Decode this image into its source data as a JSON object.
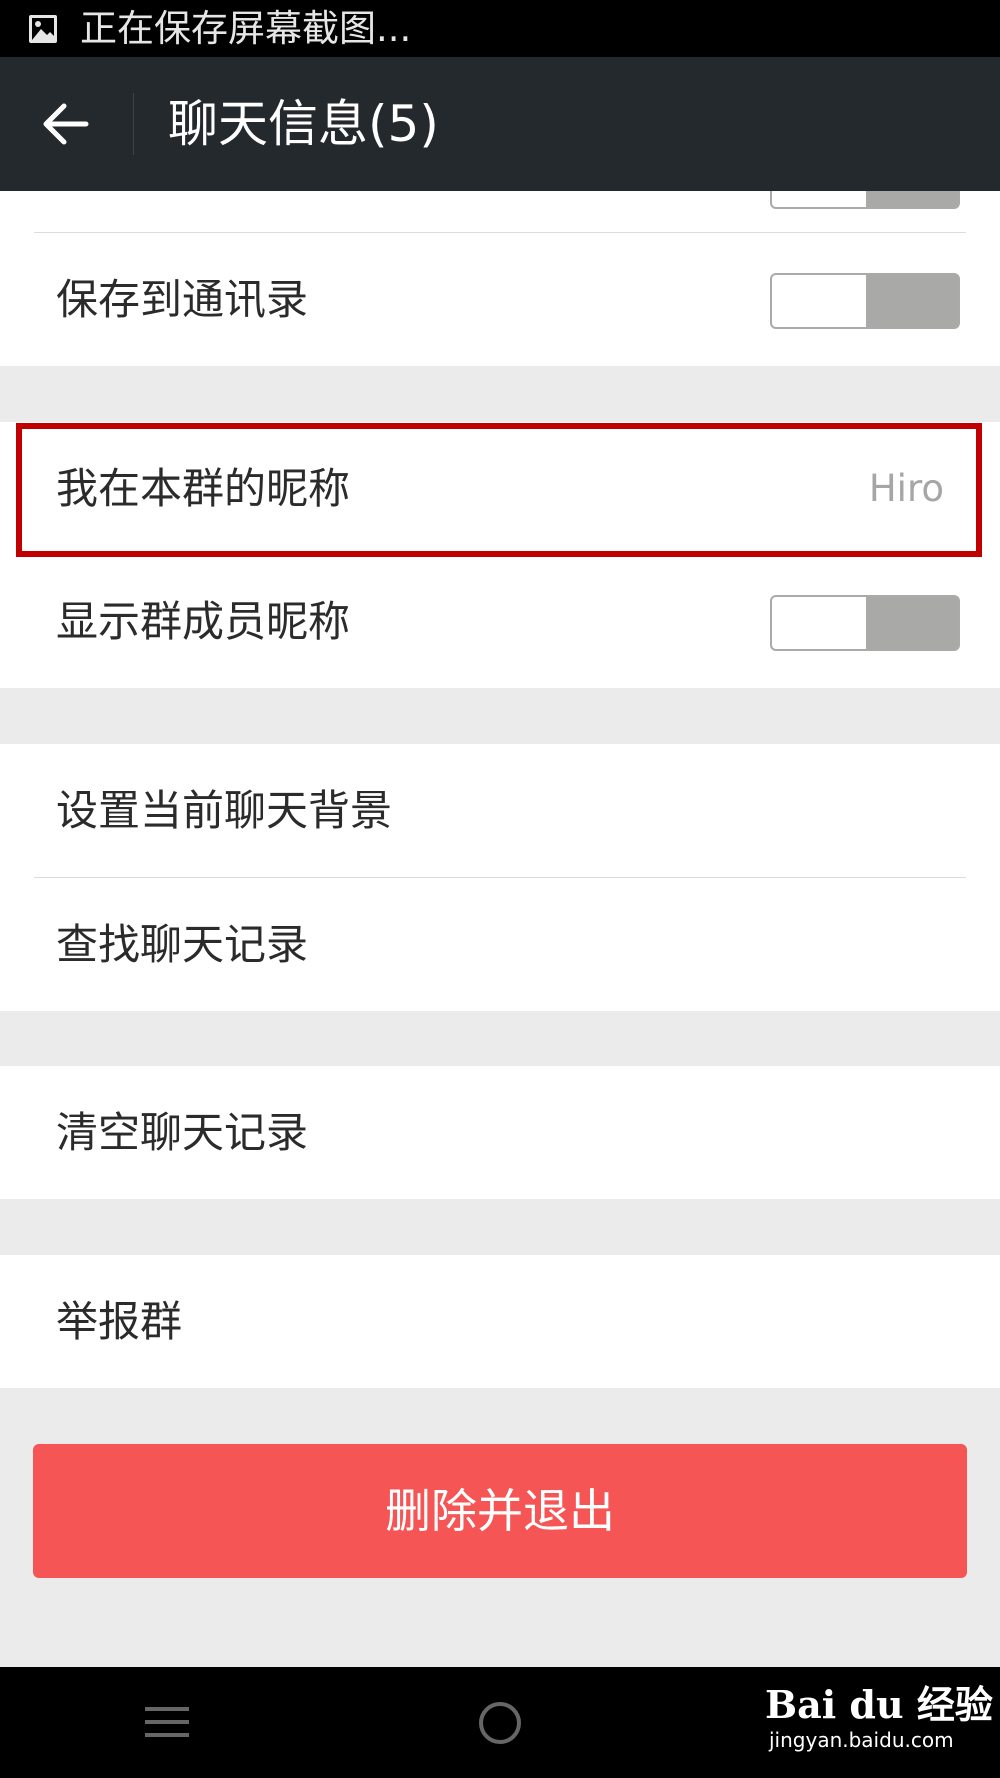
{
  "statusbar": {
    "text": "正在保存屏幕截图...",
    "icon": "image-icon"
  },
  "appbar": {
    "title": "聊天信息(5)",
    "back_icon": "back-arrow-icon"
  },
  "rows": {
    "save_contacts": {
      "label": "保存到通讯录",
      "toggle_on": false
    },
    "nickname": {
      "label": "我在本群的昵称",
      "value": "Hiro"
    },
    "show_nicknames": {
      "label": "显示群成员昵称",
      "toggle_on": false
    },
    "set_background": {
      "label": "设置当前聊天背景"
    },
    "find_history": {
      "label": "查找聊天记录"
    },
    "clear_history": {
      "label": "清空聊天记录"
    },
    "report_group": {
      "label": "举报群"
    }
  },
  "delete_button": {
    "label": "删除并退出"
  },
  "highlight_color": "#c00000",
  "danger_color": "#f55555",
  "navbar": {
    "menu_icon": "menu-icon",
    "home_icon": "home-circle-icon"
  },
  "watermark": {
    "logo": "Bai du 经验",
    "url": "jingyan.baidu.com"
  }
}
